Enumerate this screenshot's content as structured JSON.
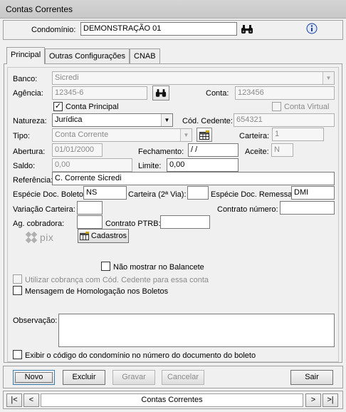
{
  "window": {
    "title": "Contas Correntes"
  },
  "header": {
    "condominio_label": "Condomínio:",
    "condominio_value": "DEMONSTRAÇÃO 01"
  },
  "tabs": [
    {
      "label": "Principal",
      "active": true
    },
    {
      "label": "Outras Configurações",
      "active": false
    },
    {
      "label": "CNAB",
      "active": false
    }
  ],
  "form": {
    "banco_label": "Banco:",
    "banco_value": "Sicredi",
    "agencia_label": "Agência:",
    "agencia_value": "12345-6",
    "conta_label": "Conta:",
    "conta_value": "123456",
    "conta_principal_label": "Conta Principal",
    "conta_principal_checked": true,
    "conta_virtual_label": "Conta Virtual",
    "natureza_label": "Natureza:",
    "natureza_value": "Jurídica",
    "cod_cedente_label": "Cód. Cedente:",
    "cod_cedente_value": "654321",
    "tipo_label": "Tipo:",
    "tipo_value": "Conta Corrente",
    "carteira_label": "Carteira:",
    "carteira_value": "1",
    "abertura_label": "Abertura:",
    "abertura_value": "01/01/2000",
    "fechamento_label": "Fechamento:",
    "fechamento_value": " / /",
    "aceite_label": "Aceite:",
    "aceite_value": "N",
    "saldo_label": "Saldo:",
    "saldo_value": "0,00",
    "limite_label": "Limite:",
    "limite_value": "0,00",
    "referencia_label": "Referência:",
    "referencia_value": "C. Corrente Sicredi",
    "especie_boleto_label": "Espécie Doc. Boleto:",
    "especie_boleto_value": "NS",
    "carteira2via_label": "Carteira (2ª Via):",
    "carteira2via_value": "",
    "especie_remessa_label": "Espécie Doc. Remessa:",
    "especie_remessa_value": "DMI",
    "variacao_label": "Variação Carteira:",
    "variacao_value": "",
    "contrato_numero_label": "Contrato número:",
    "contrato_numero_value": "",
    "ag_cobradora_label": "Ag. cobradora:",
    "ag_cobradora_value": "",
    "contrato_ptrb_label": "Contrato PTRB:",
    "contrato_ptrb_value": "",
    "pix_logo_text": "pix",
    "cadastros_label": "Cadastros",
    "nao_mostrar_label": "Não mostrar no Balancete",
    "utilizar_cobranca_label": "Utilizar cobrança com Cód. Cedente para essa conta",
    "mensagem_homologacao_label": "Mensagem de Homologação nos Boletos",
    "observacao_label": "Observação:",
    "observacao_value": "",
    "exibir_codigo_label": "Exibir o código do condomínio no número do documento do boleto"
  },
  "buttons": {
    "novo": "Novo",
    "excluir": "Excluir",
    "gravar": "Gravar",
    "cancelar": "Cancelar",
    "sair": "Sair"
  },
  "navigator": {
    "first": "|<",
    "prev": "<",
    "label": "Contas Correntes",
    "next": ">",
    "last": ">|"
  },
  "icons": {
    "search": "binoculars-icon",
    "info": "info-icon",
    "table": "table-icon",
    "pix": "pix-logo"
  },
  "colors": {
    "accent": "#1a3e9a",
    "pix": "#9a9a9a"
  }
}
